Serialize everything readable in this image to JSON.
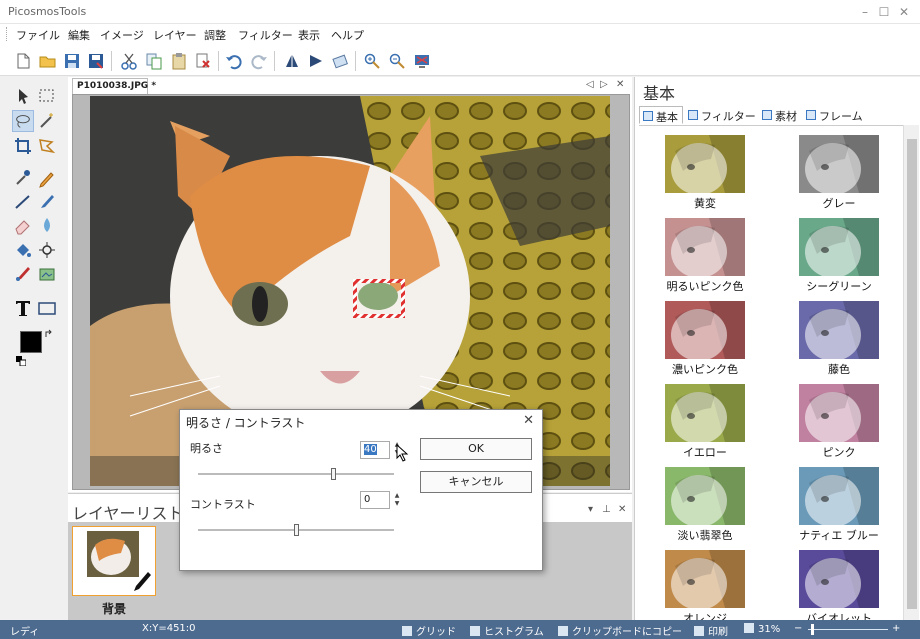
{
  "app": {
    "title": "PicosmosTools"
  },
  "window_controls": {
    "minimize": "–",
    "maximize": "☐",
    "close": "✕"
  },
  "menu": [
    "ファイル",
    "編集",
    "イメージ",
    "レイヤー",
    "調整",
    "フィルター",
    "表示",
    "ヘルプ"
  ],
  "toolbar_icons": [
    "new-file-icon",
    "open-folder-icon",
    "save-icon",
    "save-as-icon",
    "cut-icon",
    "copy-icon",
    "paste-icon",
    "delete-icon",
    "undo-icon",
    "redo-icon",
    "flip-vertical-icon",
    "flip-horizontal-icon",
    "rotate-icon",
    "zoom-in-icon",
    "zoom-out-icon",
    "fit-screen-icon"
  ],
  "tools": [
    "pointer-tool",
    "rect-select-tool",
    "lasso-tool",
    "magic-wand-tool",
    "crop-tool",
    "polygon-tool",
    "eyedropper-tool",
    "pencil-tool",
    "line-tool",
    "brush-tool",
    "eraser-tool",
    "blur-tool",
    "fill-tool",
    "spot-tool",
    "color-brush-tool",
    "stamp-tool",
    "text-tool",
    "shape-tool"
  ],
  "document": {
    "tab_title": "P1010038.JPG *",
    "nav_prev": "◁",
    "nav_next": "▷",
    "close": "✕"
  },
  "layers": {
    "header": "レイヤーリスト",
    "items": [
      {
        "name": "背景"
      }
    ],
    "ctrl_dropdown": "▾",
    "ctrl_pin": "⊥",
    "ctrl_close": "✕"
  },
  "right_panel": {
    "header": "基本",
    "tabs": [
      "基本",
      "フィルター",
      "素材",
      "フレーム"
    ],
    "active_tab": "基本",
    "filters": [
      {
        "label": "黄変",
        "tint": "#a89c3c"
      },
      {
        "label": "グレー",
        "tint": "#8a8a8a"
      },
      {
        "label": "明るいピンク色",
        "tint": "#c49090"
      },
      {
        "label": "シーグリーン",
        "tint": "#6aa88a"
      },
      {
        "label": "濃いピンク色",
        "tint": "#b05a5a"
      },
      {
        "label": "藤色",
        "tint": "#6a6aaa"
      },
      {
        "label": "イエロー",
        "tint": "#9aaa4a"
      },
      {
        "label": "ピンク",
        "tint": "#c080a0"
      },
      {
        "label": "淡い翡翠色",
        "tint": "#8ab86a"
      },
      {
        "label": "ナティエ ブルー",
        "tint": "#6a9ab8"
      },
      {
        "label": "オレンジ",
        "tint": "#c08a4a"
      },
      {
        "label": "バイオレット",
        "tint": "#5a4a9a"
      }
    ]
  },
  "dialog": {
    "title": "明るさ / コントラスト",
    "close": "✕",
    "brightness_label": "明るさ",
    "brightness_value": "40",
    "contrast_label": "コントラスト",
    "contrast_value": "0",
    "ok_label": "OK",
    "cancel_label": "キャンセル"
  },
  "statusbar": {
    "status": "レディ",
    "coords": "X:Y=451:0",
    "grid": "グリッド",
    "histogram": "ヒストグラム",
    "clipboard_copy": "クリップボードにコピー",
    "print": "印刷",
    "zoom": "31%",
    "zoom_minus": "−",
    "zoom_plus": "+"
  },
  "colors": {
    "accent": "#3a78c2",
    "statusbar": "#4d6a8f",
    "selection": "#c9dcef"
  }
}
